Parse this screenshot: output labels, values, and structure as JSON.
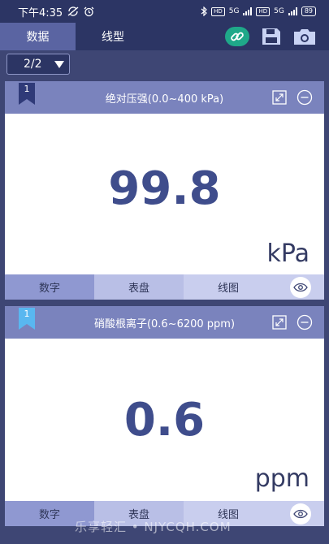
{
  "status": {
    "time": "下午4:35",
    "network1": "HD",
    "network2": "HD",
    "gen1": "5G",
    "gen2": "5G",
    "battery": "89"
  },
  "tabs": {
    "data": "数据",
    "line": "线型"
  },
  "selector": {
    "value": "2/2"
  },
  "panels": [
    {
      "index": "1",
      "title": "绝对压强(0.0~400 kPa)",
      "value": "99.8",
      "unit": "kPa",
      "tabs": [
        "数字",
        "表盘",
        "线图"
      ],
      "ribbon_color": "#2f3a78"
    },
    {
      "index": "1",
      "title": "硝酸根离子(0.6~6200 ppm)",
      "value": "0.6",
      "unit": "ppm",
      "tabs": [
        "数字",
        "表盘",
        "线图"
      ],
      "ribbon_color": "#59b7f0"
    }
  ],
  "watermark": "乐享轻汇 • NJYCQH.COM",
  "colors": {
    "accent_green": "#1fa889",
    "header": "#7a83bd",
    "reading": "#3f4d8c"
  }
}
